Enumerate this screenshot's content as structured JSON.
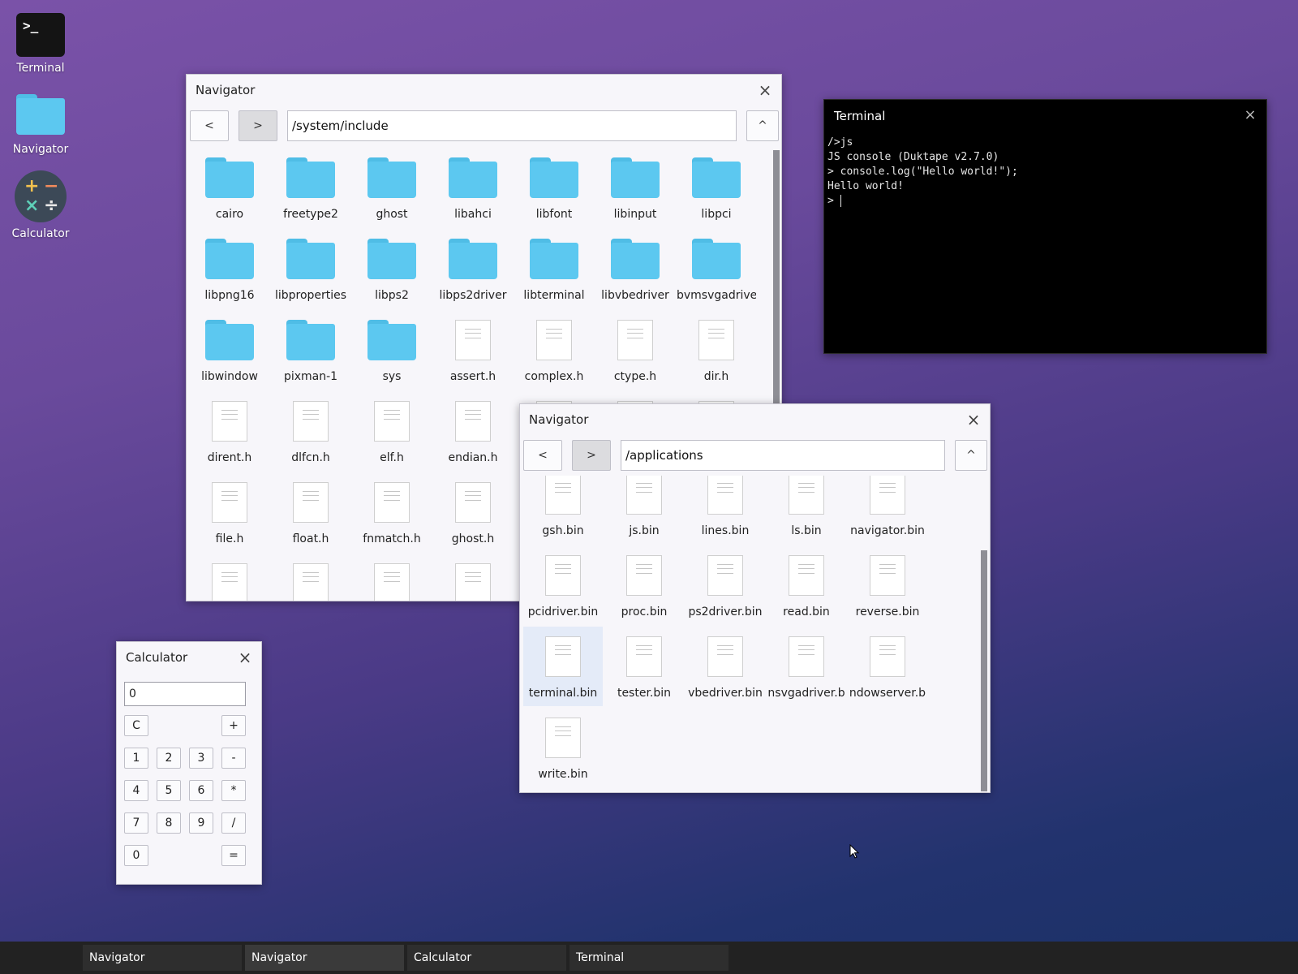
{
  "desktop": {
    "icons": [
      {
        "label": "Terminal",
        "icon": "terminal-icon"
      },
      {
        "label": "Navigator",
        "icon": "folder-icon"
      },
      {
        "label": "Calculator",
        "icon": "calculator-icon"
      }
    ]
  },
  "nav1": {
    "title": "Navigator",
    "back_label": "<",
    "forward_label": ">",
    "up_label": "^",
    "path": "/system/include",
    "items": [
      {
        "name": "cairo",
        "type": "folder"
      },
      {
        "name": "freetype2",
        "type": "folder"
      },
      {
        "name": "ghost",
        "type": "folder"
      },
      {
        "name": "libahci",
        "type": "folder"
      },
      {
        "name": "libfont",
        "type": "folder"
      },
      {
        "name": "libinput",
        "type": "folder"
      },
      {
        "name": "libpci",
        "type": "folder"
      },
      {
        "name": "libpng16",
        "type": "folder"
      },
      {
        "name": "libproperties",
        "type": "folder"
      },
      {
        "name": "libps2",
        "type": "folder"
      },
      {
        "name": "libps2driver",
        "type": "folder"
      },
      {
        "name": "libterminal",
        "type": "folder"
      },
      {
        "name": "libvbedriver",
        "type": "folder"
      },
      {
        "name": "bvmsvgadrive",
        "type": "folder"
      },
      {
        "name": "libwindow",
        "type": "folder"
      },
      {
        "name": "pixman-1",
        "type": "folder"
      },
      {
        "name": "sys",
        "type": "folder"
      },
      {
        "name": "assert.h",
        "type": "file"
      },
      {
        "name": "complex.h",
        "type": "file"
      },
      {
        "name": "ctype.h",
        "type": "file"
      },
      {
        "name": "dir.h",
        "type": "file"
      },
      {
        "name": "dirent.h",
        "type": "file"
      },
      {
        "name": "dlfcn.h",
        "type": "file"
      },
      {
        "name": "elf.h",
        "type": "file"
      },
      {
        "name": "endian.h",
        "type": "file"
      },
      {
        "name": "",
        "type": "file"
      },
      {
        "name": "",
        "type": "file"
      },
      {
        "name": "",
        "type": "file"
      },
      {
        "name": "file.h",
        "type": "file"
      },
      {
        "name": "float.h",
        "type": "file"
      },
      {
        "name": "fnmatch.h",
        "type": "file"
      },
      {
        "name": "ghost.h",
        "type": "file"
      },
      {
        "name": "",
        "type": "file"
      },
      {
        "name": "",
        "type": "file"
      },
      {
        "name": "",
        "type": "file"
      },
      {
        "name": "",
        "type": "file"
      },
      {
        "name": "",
        "type": "file"
      },
      {
        "name": "",
        "type": "file"
      },
      {
        "name": "",
        "type": "file"
      }
    ]
  },
  "nav2": {
    "title": "Navigator",
    "back_label": "<",
    "forward_label": ">",
    "up_label": "^",
    "path": "/applications",
    "items": [
      {
        "name": "gsh.bin",
        "type": "file"
      },
      {
        "name": "js.bin",
        "type": "file"
      },
      {
        "name": "lines.bin",
        "type": "file"
      },
      {
        "name": "ls.bin",
        "type": "file"
      },
      {
        "name": "navigator.bin",
        "type": "file"
      },
      {
        "name": "pcidriver.bin",
        "type": "file"
      },
      {
        "name": "proc.bin",
        "type": "file"
      },
      {
        "name": "ps2driver.bin",
        "type": "file"
      },
      {
        "name": "read.bin",
        "type": "file"
      },
      {
        "name": "reverse.bin",
        "type": "file"
      },
      {
        "name": "terminal.bin",
        "type": "file",
        "selected": true
      },
      {
        "name": "tester.bin",
        "type": "file"
      },
      {
        "name": "vbedriver.bin",
        "type": "file"
      },
      {
        "name": "nsvgadriver.b",
        "type": "file"
      },
      {
        "name": "ndowserver.b",
        "type": "file"
      },
      {
        "name": "write.bin",
        "type": "file"
      }
    ]
  },
  "terminal": {
    "title": "Terminal",
    "lines": [
      "/>js",
      "JS console (Duktape v2.7.0)",
      "> console.log(\"Hello world!\");",
      "Hello world!",
      "> "
    ]
  },
  "calculator": {
    "title": "Calculator",
    "display": "0",
    "buttons": [
      {
        "label": "C",
        "row": 0,
        "col": 0
      },
      {
        "label": "+",
        "row": 0,
        "col": 3
      },
      {
        "label": "1",
        "row": 1,
        "col": 0
      },
      {
        "label": "2",
        "row": 1,
        "col": 1
      },
      {
        "label": "3",
        "row": 1,
        "col": 2
      },
      {
        "label": "-",
        "row": 1,
        "col": 3
      },
      {
        "label": "4",
        "row": 2,
        "col": 0
      },
      {
        "label": "5",
        "row": 2,
        "col": 1
      },
      {
        "label": "6",
        "row": 2,
        "col": 2
      },
      {
        "label": "*",
        "row": 2,
        "col": 3
      },
      {
        "label": "7",
        "row": 3,
        "col": 0
      },
      {
        "label": "8",
        "row": 3,
        "col": 1
      },
      {
        "label": "9",
        "row": 3,
        "col": 2
      },
      {
        "label": "/",
        "row": 3,
        "col": 3
      },
      {
        "label": "0",
        "row": 4,
        "col": 0
      },
      {
        "label": "=",
        "row": 4,
        "col": 3
      }
    ]
  },
  "taskbar": {
    "tasks": [
      {
        "label": "Navigator",
        "active": false
      },
      {
        "label": "Navigator",
        "active": true
      },
      {
        "label": "Calculator",
        "active": false
      },
      {
        "label": "Terminal",
        "active": false
      }
    ]
  },
  "colors": {
    "folder": "#5cc8f0",
    "taskbar": "#222222",
    "terminal_bg": "#000000"
  }
}
